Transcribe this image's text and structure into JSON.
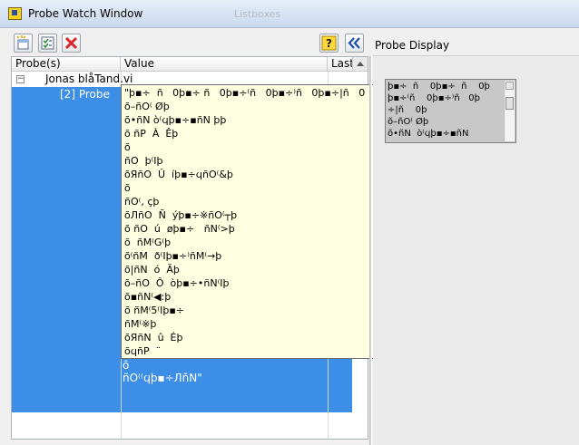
{
  "window": {
    "title": "Probe Watch Window",
    "ghost_title": "Listboxes"
  },
  "toolbar": {
    "buttons": [
      "new-probe",
      "select-probes",
      "delete-probe",
      "help",
      "collapse"
    ]
  },
  "table": {
    "columns": [
      "Probe(s)",
      "Value",
      "Last"
    ],
    "tree_toggle": "−",
    "group_label": "Jonas blåTand.vi",
    "selected_item": "[2] Probe",
    "value_tail": [
      "õ",
      "ñO⁽⁽ϥþ▪÷ЛñN\""
    ],
    "tooltip_lines": [
      "\"þ▪÷  ñ   0þ▪÷ ñ   0þ▪÷⁽ñ   0þ▪÷⁾ñ   0þ▪÷|ñ   0",
      "õ–ñO⁽ Øþ",
      "õ•ñN ò⁽ϥþ▪÷▪ñN þþ",
      "õ ñP  À  Êþ",
      "õ",
      "ñO  þ⁽Ιþ",
      "õЯñO  Û  íþ▪÷ϥñO⁽&þ",
      "õ",
      "ñO⁽, çþ",
      "õЛñO  Ñ  ýþ▪÷※ñO⁽┬þ",
      "õ ñO  ú  øþ▪÷   ñN⁽>þ",
      "õ  ñM⁽G⁽þ",
      "õ⁽ñM  ð⁽Ιþ▪÷⁾ñM⁽→þ",
      "õ|ñN  ó  Ãþ",
      "õ–ñO  Ô  òþ▪÷•ñN⁽Ιþ",
      "õ▪ñN⁽◀:þ",
      "õ ñM⁽5⁽Ιþ▪÷",
      "ñM⁽※þ",
      "õЯñN  û  Éþ",
      "õϥñP  ¨"
    ]
  },
  "probe_display": {
    "label": "Probe Display",
    "lines": [
      "þ▪÷  ñ    0þ▪÷  ñ    0þ",
      "þ▪÷⁽ñ    0þ▪÷⁾ñ   0þ",
      "÷|ñ    0þ",
      "õ–ñO⁽ Øþ",
      "õ•ñN  ò⁽ϥþ▪÷▪ñN"
    ]
  },
  "colors": {
    "selection": "#3d8ee6",
    "tooltip_bg": "#ffffe1",
    "delete_red": "#d62828",
    "collapse_blue": "#1f4fa8"
  }
}
